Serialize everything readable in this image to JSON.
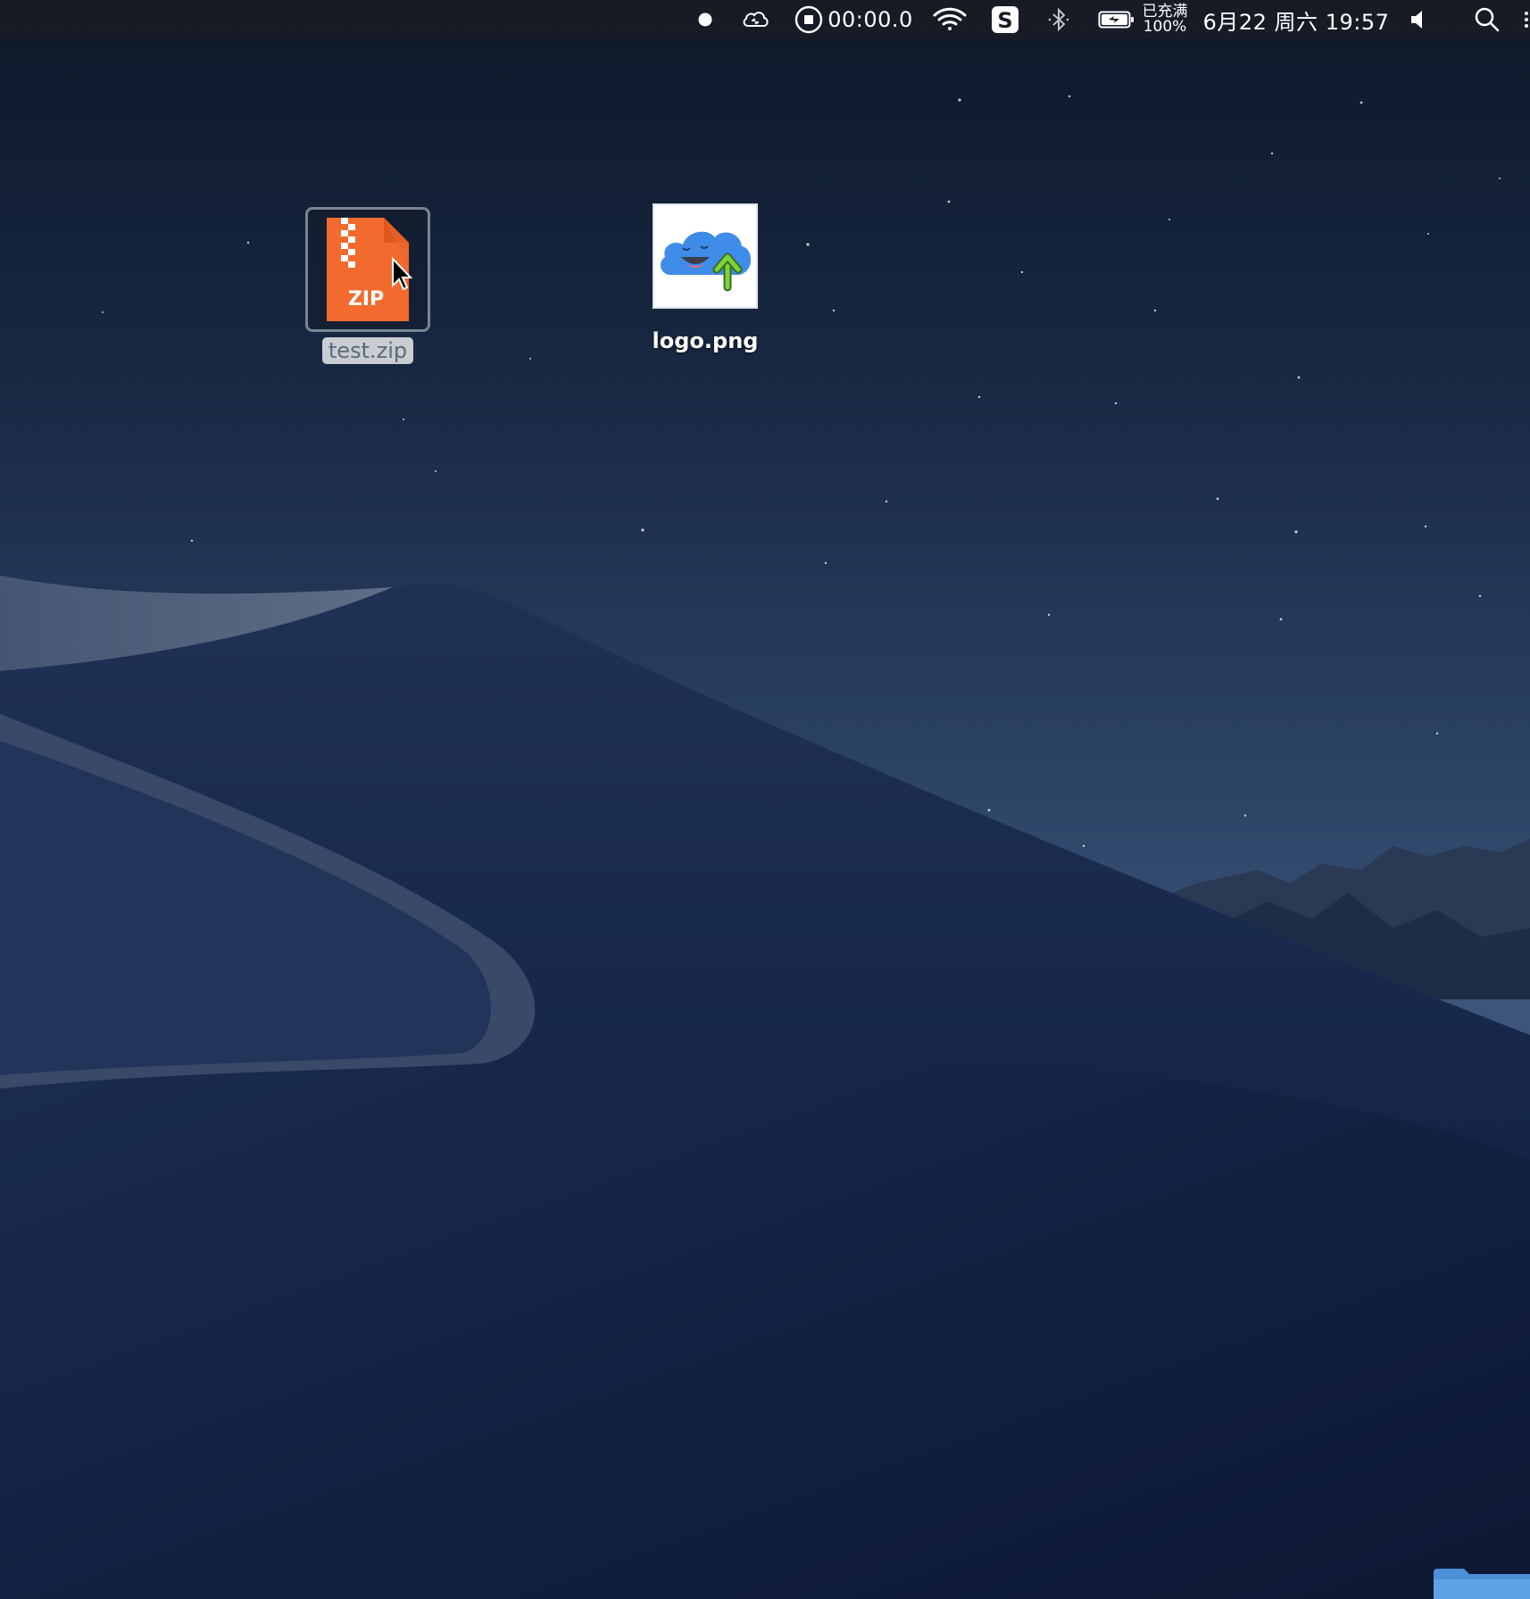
{
  "menubar": {
    "record_status_icon": "recording-dot-icon",
    "cloud_icon": "cloud-sync-icon",
    "stop_icon": "stop-recording-icon",
    "timer": "00:00.0",
    "wifi_icon": "wifi-icon",
    "sogou_icon": "sogou-input-icon",
    "bluetooth_icon": "bluetooth-icon",
    "battery_icon": "battery-charging-icon",
    "battery_status": "已充满",
    "battery_percent": "100%",
    "datetime": "6月22 周六 19:57",
    "volume_icon": "volume-icon",
    "search_icon": "spotlight-search-icon"
  },
  "desktop": {
    "icons": [
      {
        "label": "test.zip",
        "type": "zip",
        "badge": "ZIP",
        "selected": true
      },
      {
        "label": "logo.png",
        "type": "png",
        "selected": false
      }
    ]
  },
  "colors": {
    "zip_orange": "#f26a2e",
    "zip_orange_dark": "#e0561f",
    "cloud_blue": "#3f8ce8",
    "arrow_green": "#7ed23a",
    "menubar_bg": "#181c26"
  }
}
